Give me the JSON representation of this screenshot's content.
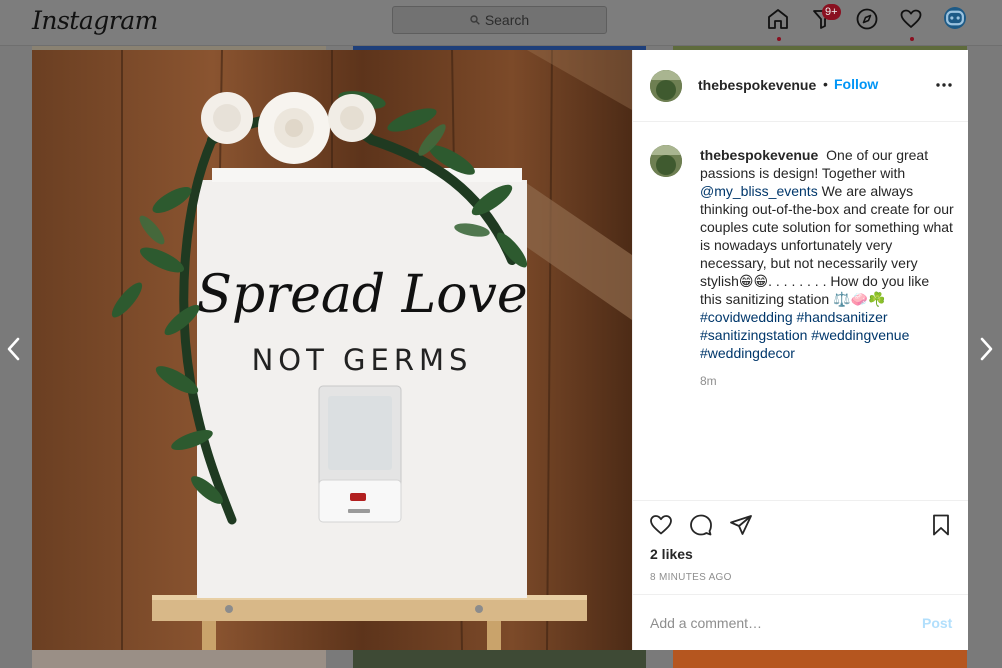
{
  "nav": {
    "logo": "Instagram",
    "search_placeholder": "Search",
    "notification_badge": "9+"
  },
  "post": {
    "username": "thebespokevenue",
    "follow_label": "Follow",
    "separator": "•",
    "caption_text_1": "One of our great passions is design! Together with",
    "mention": "@my_bliss_events",
    "caption_text_2": "We are always thinking out-of-the-box and create for our couples cute solution for something what is nowadays unfortunately very necessary, but not necessarily very stylish",
    "caption_emoji_1": "😁😁",
    "caption_text_3": ". . . . . . . . How do you like this sanitizing station",
    "caption_emoji_2": "⚖️🧼☘️",
    "hashtags": [
      "#covidwedding",
      "#handsanitizer",
      "#sanitizingstation",
      "#weddingvenue",
      "#weddingdecor"
    ],
    "timestamp_short": "8m",
    "likes": "2 likes",
    "time_ago": "8 MINUTES AGO",
    "comment_placeholder": "Add a comment…",
    "post_label": "Post"
  },
  "photo": {
    "sign_line_1": "Spread Love",
    "sign_line_2": "NOT GERMS"
  },
  "colors": {
    "follow_blue": "#0095f6",
    "post_disabled": "#b2dffc",
    "hashtag": "#00376b",
    "badge": "#8a1020"
  }
}
